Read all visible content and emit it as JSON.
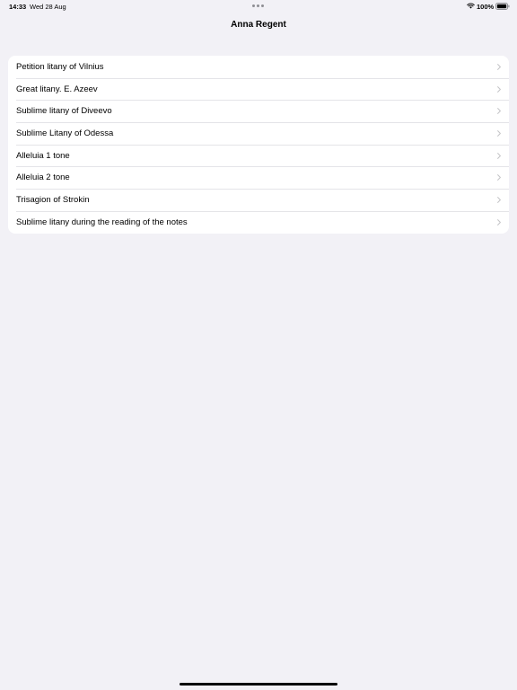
{
  "status_bar": {
    "time": "14:33",
    "date": "Wed 28 Aug",
    "battery": "100%"
  },
  "nav": {
    "title": "Anna Regent"
  },
  "list": {
    "items": [
      {
        "label": "Petition litany of Vilnius"
      },
      {
        "label": "Great litany. E. Azeev"
      },
      {
        "label": "Sublime litany of Diveevo"
      },
      {
        "label": "Sublime Litany of Odessa"
      },
      {
        "label": "Alleluia 1 tone"
      },
      {
        "label": "Alleluia 2 tone"
      },
      {
        "label": "Trisagion of Strokin"
      },
      {
        "label": "Sublime litany during the reading of the notes"
      }
    ]
  },
  "colors": {
    "background": "#f2f1f6",
    "card": "#ffffff",
    "chevron": "#c4c4c7"
  },
  "icons": {
    "wifi": "wifi-icon",
    "battery": "battery-icon",
    "chevron": "chevron-right-icon"
  }
}
